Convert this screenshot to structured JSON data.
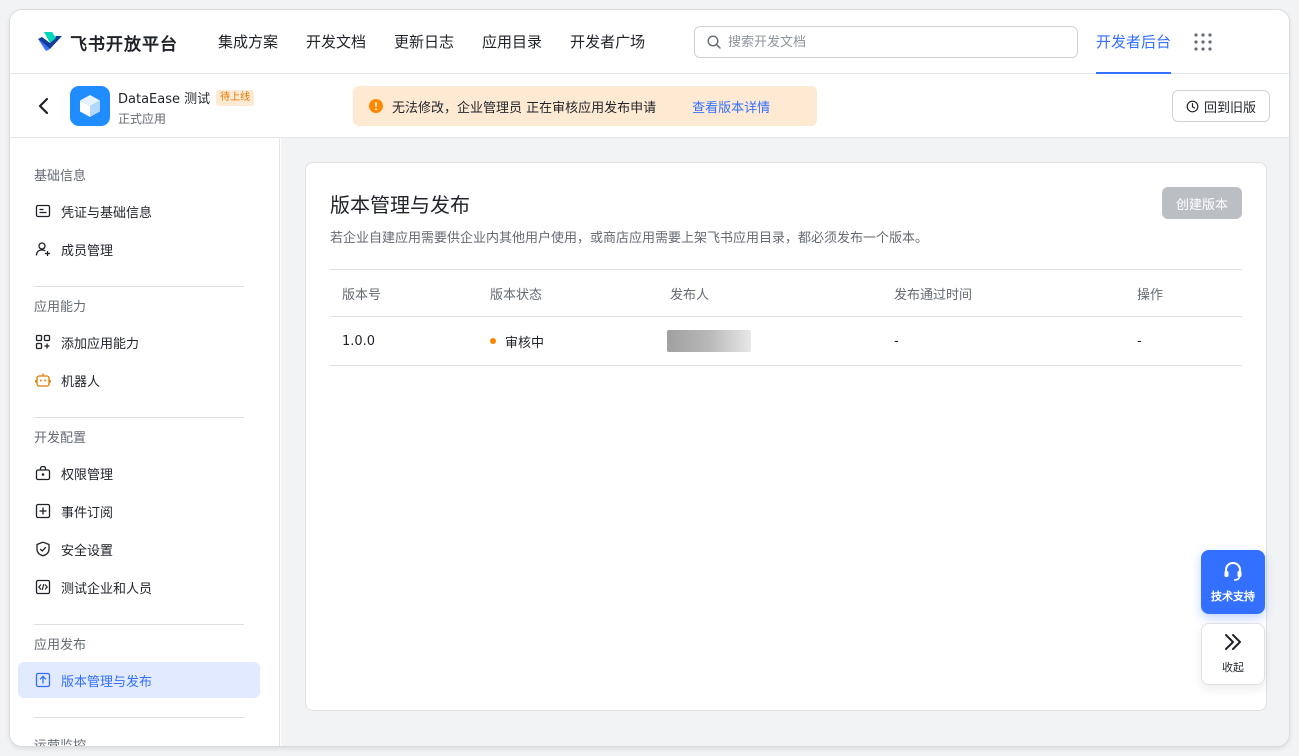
{
  "brand": {
    "name": "飞书开放平台",
    "logo_icon": "feishu-logo-icon"
  },
  "nav": {
    "items": [
      {
        "label": "集成方案"
      },
      {
        "label": "开发文档"
      },
      {
        "label": "更新日志"
      },
      {
        "label": "应用目录"
      },
      {
        "label": "开发者广场"
      }
    ],
    "search_placeholder": "搜索开发文档",
    "dev_console": "开发者后台"
  },
  "app": {
    "name": "DataEase 测试",
    "badge": "待上线",
    "subtitle": "正式应用"
  },
  "notice": {
    "text": "无法修改，企业管理员 正在审核应用发布申请",
    "link": "查看版本详情"
  },
  "header_actions": {
    "back_to_old": "回到旧版"
  },
  "sidebar": {
    "groups": [
      {
        "title": "基础信息",
        "items": [
          {
            "label": "凭证与基础信息"
          },
          {
            "label": "成员管理"
          }
        ]
      },
      {
        "title": "应用能力",
        "items": [
          {
            "label": "添加应用能力"
          },
          {
            "label": "机器人"
          }
        ]
      },
      {
        "title": "开发配置",
        "items": [
          {
            "label": "权限管理"
          },
          {
            "label": "事件订阅"
          },
          {
            "label": "安全设置"
          },
          {
            "label": "测试企业和人员"
          }
        ]
      },
      {
        "title": "应用发布",
        "items": [
          {
            "label": "版本管理与发布"
          }
        ]
      },
      {
        "title": "运营监控"
      }
    ]
  },
  "card": {
    "title": "版本管理与发布",
    "description": "若企业自建应用需要供企业内其他用户使用，或商店应用需要上架飞书应用目录，都必须发布一个版本。",
    "create_button": "创建版本",
    "table": {
      "columns": [
        "版本号",
        "版本状态",
        "发布人",
        "发布通过时间",
        "操作"
      ],
      "rows": [
        {
          "version": "1.0.0",
          "status": "审核中",
          "publisher": "",
          "pass_time": "-",
          "action": "-"
        }
      ]
    }
  },
  "floating": {
    "support": "技术支持",
    "collapse": "收起"
  },
  "colors": {
    "accent": "#3370ff",
    "warning_bg": "#feead2",
    "warning": "#ff8800"
  }
}
